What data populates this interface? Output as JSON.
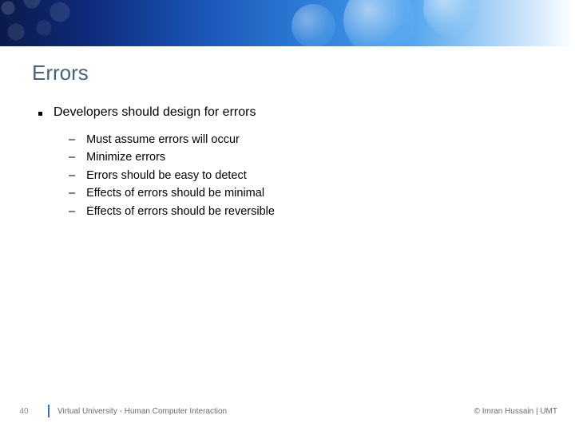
{
  "title": "Errors",
  "bullets": [
    {
      "text": "Developers should design for errors",
      "sub": [
        "Must assume errors will occur",
        "Minimize errors",
        "Errors should be easy to detect",
        "Effects of errors should be minimal",
        "Effects of errors should be reversible"
      ]
    }
  ],
  "footer": {
    "page": "40",
    "course": "Virtual University - Human Computer Interaction",
    "credit": "© Imran Hussain | UMT"
  }
}
